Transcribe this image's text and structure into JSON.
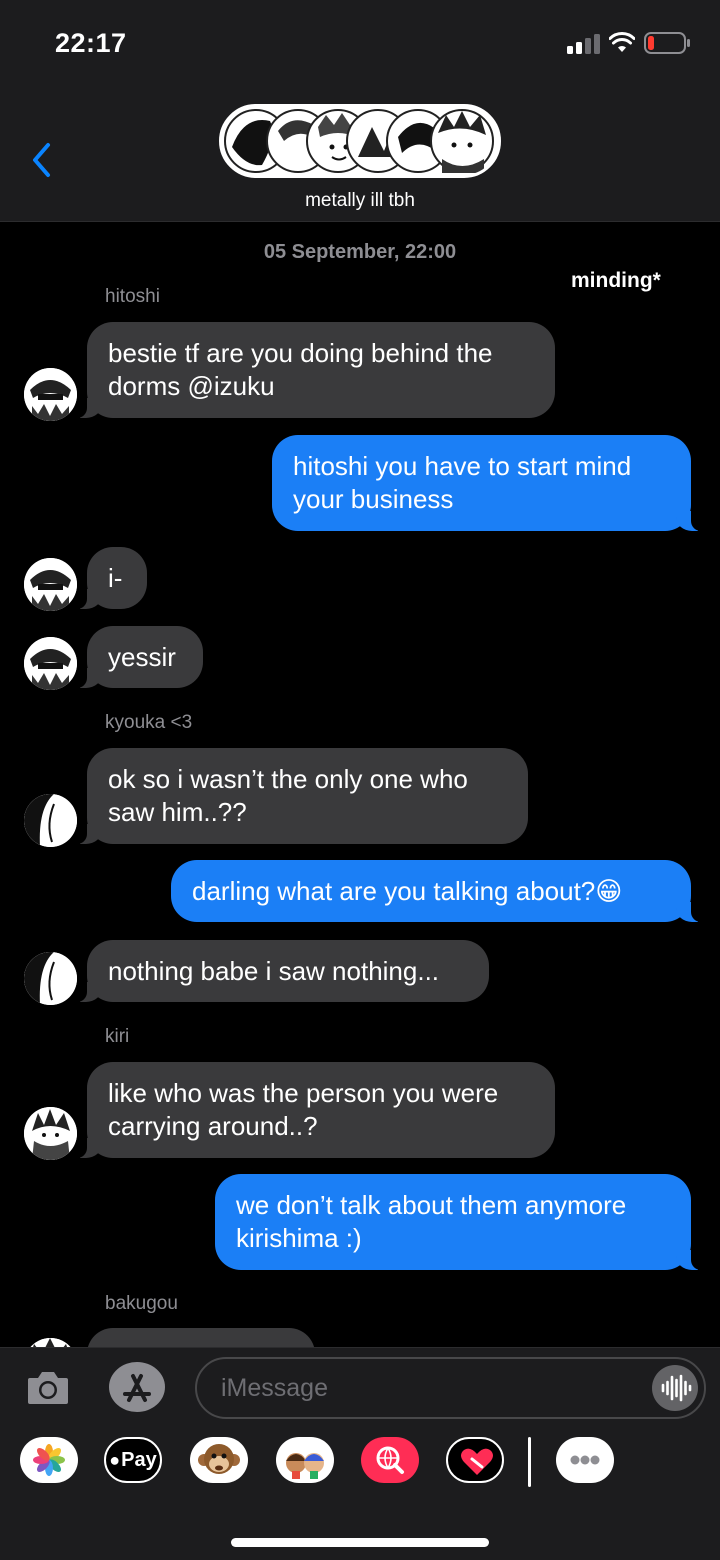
{
  "status_bar": {
    "time": "22:17"
  },
  "header": {
    "group_name": "metally ill tbh"
  },
  "conversation": {
    "timestamp": "05 September, 22:00",
    "annotation": "minding*",
    "senders": [
      "hitoshi",
      "kyouka <3",
      "kiri",
      "bakugou"
    ],
    "messages": [
      {
        "from": "hitoshi",
        "direction": "incoming",
        "text": "bestie tf are you doing behind the\ndorms @izuku"
      },
      {
        "from": "me",
        "direction": "outgoing",
        "text": "hitoshi you have to start mind\nyour business"
      },
      {
        "from": "hitoshi",
        "direction": "incoming",
        "text": "i-"
      },
      {
        "from": "hitoshi",
        "direction": "incoming",
        "text": "yessir"
      },
      {
        "from": "kyouka <3",
        "direction": "incoming",
        "text": "ok so i wasn’t the only one who\nsaw him..??"
      },
      {
        "from": "me",
        "direction": "outgoing",
        "text": "darling what are you talking about?😁"
      },
      {
        "from": "kyouka <3",
        "direction": "incoming",
        "text": "nothing babe i saw nothing..."
      },
      {
        "from": "kiri",
        "direction": "incoming",
        "text": "like who was the person you were\ncarrying around..?"
      },
      {
        "from": "me",
        "direction": "outgoing",
        "text": "we don’t talk about them anymore\nkirishima :)"
      }
    ]
  },
  "composer": {
    "placeholder": "iMessage"
  },
  "app_drawer": {
    "apps": [
      "photos-icon",
      "apple-pay-icon",
      "animoji-icon",
      "memoji-icon",
      "web-search-icon",
      "digital-touch-icon",
      "more-icon"
    ],
    "apple_pay_label": "Pay"
  },
  "colors": {
    "outgoing_bubble": "#1b7ff6",
    "incoming_bubble": "#3a3a3c",
    "background": "#000000",
    "accent": "#0a84ff"
  }
}
